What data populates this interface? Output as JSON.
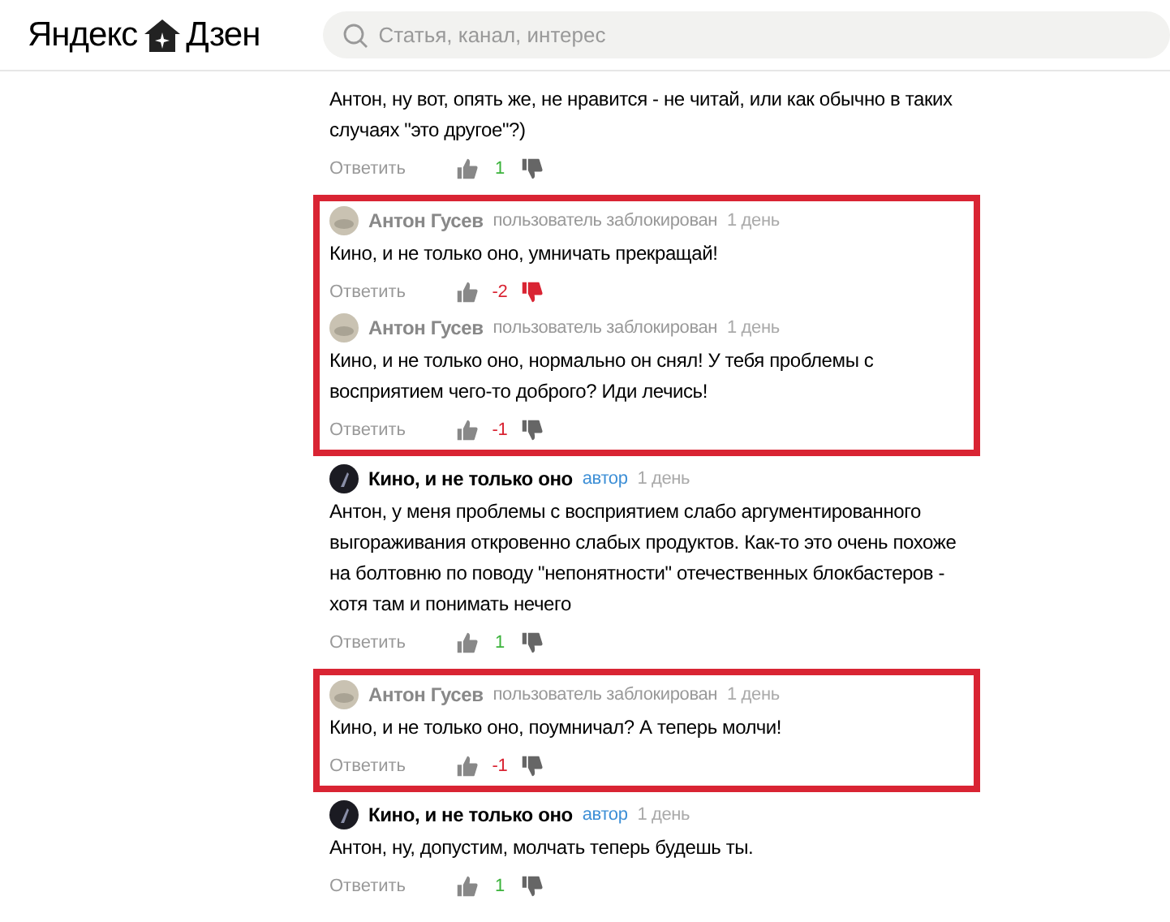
{
  "header": {
    "logo_left": "Яндекс",
    "logo_right": "Дзен",
    "search": {
      "placeholder": "Статья, канал, интерес"
    }
  },
  "items": [
    {
      "kind": "comment",
      "comment": {
        "text": "Антон, ну вот, опять же, не нравится - не читай, или как обычно в таких случаях \"это другое\"?)",
        "reply": "Ответить",
        "score": {
          "text": "1",
          "color": "#3cb33c"
        },
        "disliked": false
      }
    },
    {
      "kind": "highlight",
      "comments": [
        {
          "kind": "blocked",
          "author": "Антон Гусев",
          "badge": "пользователь заблокирован",
          "time": "1 день",
          "text": "Кино, и не только оно, умничать прекращай!",
          "reply": "Ответить",
          "score": {
            "text": "-2",
            "color": "#d92433"
          },
          "disliked": true
        },
        {
          "kind": "blocked",
          "author": "Антон Гусев",
          "badge": "пользователь заблокирован",
          "time": "1 день",
          "text": "Кино, и не только оно, нормально он снял! У тебя проблемы с восприятием чего-то доброго? Иди лечись!",
          "reply": "Ответить",
          "score": {
            "text": "-1",
            "color": "#d92433"
          },
          "disliked": false
        }
      ]
    },
    {
      "kind": "comment",
      "comment": {
        "kind": "author",
        "author": "Кино, и не только оно",
        "badge": "автор",
        "time": "1 день",
        "text": "Антон, у меня проблемы с восприятием слабо аргументированного выгораживания откровенно слабых продуктов. Как-то это очень похоже на болтовню по поводу \"непонятности\" отечественных блокбастеров - хотя там и понимать нечего",
        "reply": "Ответить",
        "score": {
          "text": "1",
          "color": "#3cb33c"
        },
        "disliked": false
      }
    },
    {
      "kind": "highlight",
      "comments": [
        {
          "kind": "blocked",
          "author": "Антон Гусев",
          "badge": "пользователь заблокирован",
          "time": "1 день",
          "text": "Кино, и не только оно, поумничал? А теперь молчи!",
          "reply": "Ответить",
          "score": {
            "text": "-1",
            "color": "#d92433"
          },
          "disliked": false
        }
      ]
    },
    {
      "kind": "comment",
      "comment": {
        "kind": "author",
        "author": "Кино, и не только оно",
        "badge": "автор",
        "time": "1 день",
        "text": "Антон, ну, допустим, молчать теперь будешь ты.",
        "reply": "Ответить",
        "score": {
          "text": "1",
          "color": "#3cb33c"
        },
        "disliked": false
      }
    }
  ]
}
